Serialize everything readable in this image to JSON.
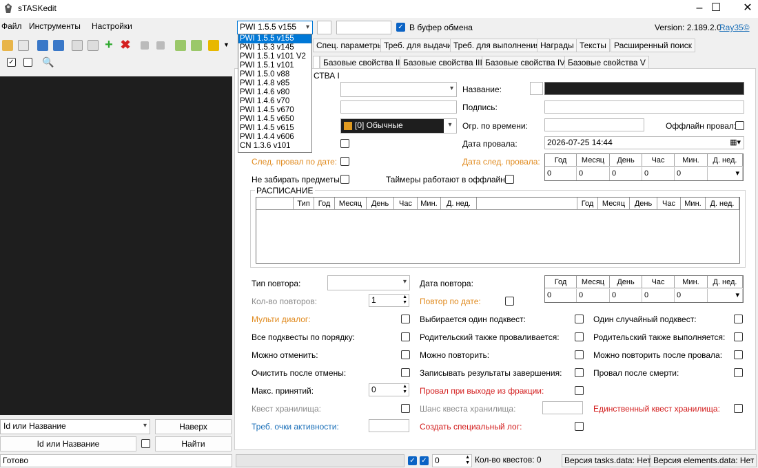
{
  "window": {
    "title": "sTASKedit",
    "minimize": "–",
    "maximize": "☐",
    "close": "✕"
  },
  "menu": {
    "file": "Файл",
    "tools": "Инструменты",
    "settings": "Настройки"
  },
  "version_select": {
    "value": "PWI 1.5.5 v155",
    "options": [
      "PWI 1.5.5 v155",
      "PWI 1.5.3 v145",
      "PWI 1.5.1 v101 V2",
      "PWI 1.5.1 v101",
      "PWI 1.5.0 v88",
      "PWI 1.4.8 v85",
      "PWI 1.4.6 v80",
      "PWI 1.4.6 v70",
      "PWI 1.4.5 v670",
      "PWI 1.4.5 v650",
      "PWI 1.4.5 v615",
      "PWI 1.4.4 v606",
      "CN 1.3.6 v101"
    ]
  },
  "clipboard": {
    "label": "В буфер обмена",
    "checked": true
  },
  "version_info": {
    "label": "Version: 2.189.2.0",
    "author": "Ray35©"
  },
  "tabs_row1": [
    "Спец. параметры",
    "Треб. для выдачи",
    "Треб. для выполнения",
    "Награды",
    "Тексты",
    "Расширенный поиск"
  ],
  "tabs_row2": [
    "Базовые свойства II",
    "Базовые свойства III",
    "Базовые свойства IV",
    "Базовые свойства V"
  ],
  "section_title": "СТВА I",
  "form": {
    "name_label": "Название:",
    "caption_label": "Подпись:",
    "time_limit_label": "Огр. по времени:",
    "offline_fail_label": "Оффлайн провал:",
    "fail_date_label": "Дата провала:",
    "fail_date_value": "2026-07-25 14:44",
    "next_fail_by_date": "След. провал по дате:",
    "next_fail_date": "Дата след. провала:",
    "no_take_items": "Не забирать предметы:",
    "offline_timers": "Таймеры работают в оффлайне:",
    "type_value": "[0] Обычные"
  },
  "date_grid_headers": [
    "Год",
    "Месяц",
    "День",
    "Час",
    "Мин.",
    "Д. нед."
  ],
  "date_grid_values": [
    "0",
    "0",
    "0",
    "0",
    "0",
    ""
  ],
  "schedule": {
    "title": "РАСПИСАНИЕ",
    "headers_left": [
      "Тип",
      "Год",
      "Месяц",
      "День",
      "Час",
      "Мин.",
      "Д. нед."
    ],
    "headers_right": [
      "Год",
      "Месяц",
      "День",
      "Час",
      "Мин.",
      "Д. нед."
    ]
  },
  "repeat": {
    "type_label": "Тип повтора:",
    "date_label": "Дата повтора:",
    "count_label": "Кол-во повторов:",
    "count_value": "1",
    "by_date_label": "Повтор по дате:"
  },
  "options": {
    "multi_dialog": "Мульти диалог:",
    "one_subquest": "Выбирается один подквест:",
    "random_subquest": "Один случайный подквест:",
    "all_in_order": "Все подквесты по порядку:",
    "parent_fails": "Родительский также проваливается:",
    "parent_completes": "Родительский также выполняется:",
    "can_cancel": "Можно отменить:",
    "can_repeat": "Можно повторить:",
    "can_repeat_after_fail": "Можно повторить после провала:",
    "clear_after_cancel": "Очистить после отмены:",
    "record_results": "Записывать результаты завершения:",
    "fail_on_death": "Провал после смерти:",
    "max_accept": "Макс. принятий:",
    "max_accept_value": "0",
    "fail_on_faction_leave": "Провал при выходе из фракции:",
    "storage_quest": "Квест хранилища:",
    "storage_chance": "Шанс квеста хранилища:",
    "only_storage_quest": "Единственный квест хранилища:",
    "activity_points": "Треб. очки активности:",
    "create_special_log": "Создать специальный лог:"
  },
  "left_panel": {
    "search_combo": "Id или Название",
    "up_button": "Наверх",
    "search_field": "Id или Название",
    "find_button": "Найти"
  },
  "status": {
    "ready": "Готово",
    "spin_value": "0",
    "quest_count": "Кол-во квестов: 0",
    "tasks_version": "Версия tasks.data: Нет",
    "elements_version": "Версия elements.data: Нет"
  }
}
